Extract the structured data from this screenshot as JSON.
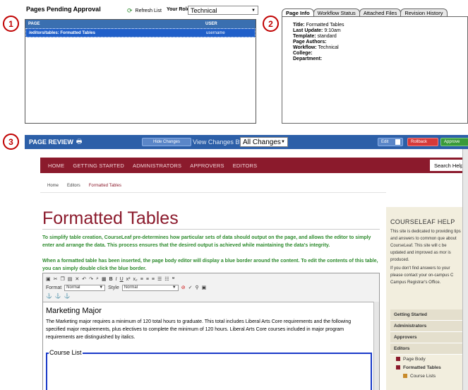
{
  "callouts": [
    "1",
    "2",
    "3"
  ],
  "pending": {
    "title": "Pages Pending Approval",
    "refresh_label": "Refresh List",
    "role_label": "Your Role",
    "role_value": "Technical",
    "columns": [
      "PAGE",
      "USER"
    ],
    "rows": [
      {
        "page": "/editors/tables: Formatted Tables",
        "user": "username"
      }
    ]
  },
  "info": {
    "tabs": [
      "Page Info",
      "Workflow Status",
      "Attached Files",
      "Revision History"
    ],
    "fields": [
      {
        "label": "Title:",
        "value": "Formatted Tables"
      },
      {
        "label": "Last Update:",
        "value": "9:10am"
      },
      {
        "label": "Template:",
        "value": "standard"
      },
      {
        "label": "Page Authors:",
        "value": ""
      },
      {
        "label": "Workflow:",
        "value": "Technical"
      },
      {
        "label": "College:",
        "value": ""
      },
      {
        "label": "Department:",
        "value": ""
      }
    ]
  },
  "review": {
    "title": "PAGE REVIEW",
    "hide_changes": "Hide Changes",
    "view_changes_label": "View Changes By:",
    "view_changes_value": "All Changes",
    "edit_label": "Edit",
    "rollback_label": "Rollback",
    "approve_label": "Approve"
  },
  "site": {
    "nav": [
      "HOME",
      "GETTING STARTED",
      "ADMINISTRATORS",
      "APPROVERS",
      "EDITORS"
    ],
    "search_placeholder": "Search Help",
    "breadcrumbs": [
      "Home",
      "Editors",
      "Formatted Tables"
    ],
    "heading": "Formatted Tables",
    "para1": "To simplify table creation, CourseLeaf pre-determines how particular sets of data should output on the page, and allows the editor to simply enter and arrange the data. This process ensures that the desired output is achieved while maintaining the data's integrity.",
    "para2": "When a formatted table has been inserted, the page body editor will display a blue border around the content. To edit the contents of this table, you can simply double click the blue border.",
    "toolbar": {
      "format_label": "Format",
      "format_value": "Normal",
      "style_label": "Style",
      "style_value": "Normal"
    },
    "editor": {
      "heading": "Marketing Major",
      "para": "The Marketing major requires a minimum of 120 total hours to graduate. This total includes Liberal Arts Core requirements and the following specified major requirements, plus electives to complete the minimum of 120 hours. Liberal Arts Core courses included in major program requirements are distinguished by italics.",
      "course_list": "Course List"
    },
    "sidebar": {
      "title": "COURSELEAF HELP",
      "p1": "This site is dedicated to providing tips and answers to common que about CourseLeaf. This site will c be updated and improved as mor is produced.",
      "p2": "If you don't find answers to your please contact your on-campus C Campus Registrar's Office.",
      "menu": [
        "Getting Started",
        "Administrators",
        "Approvers",
        "Editors"
      ],
      "sub": [
        "Page Body",
        "Formatted Tables"
      ],
      "subsub": [
        "Course Lists"
      ]
    }
  }
}
